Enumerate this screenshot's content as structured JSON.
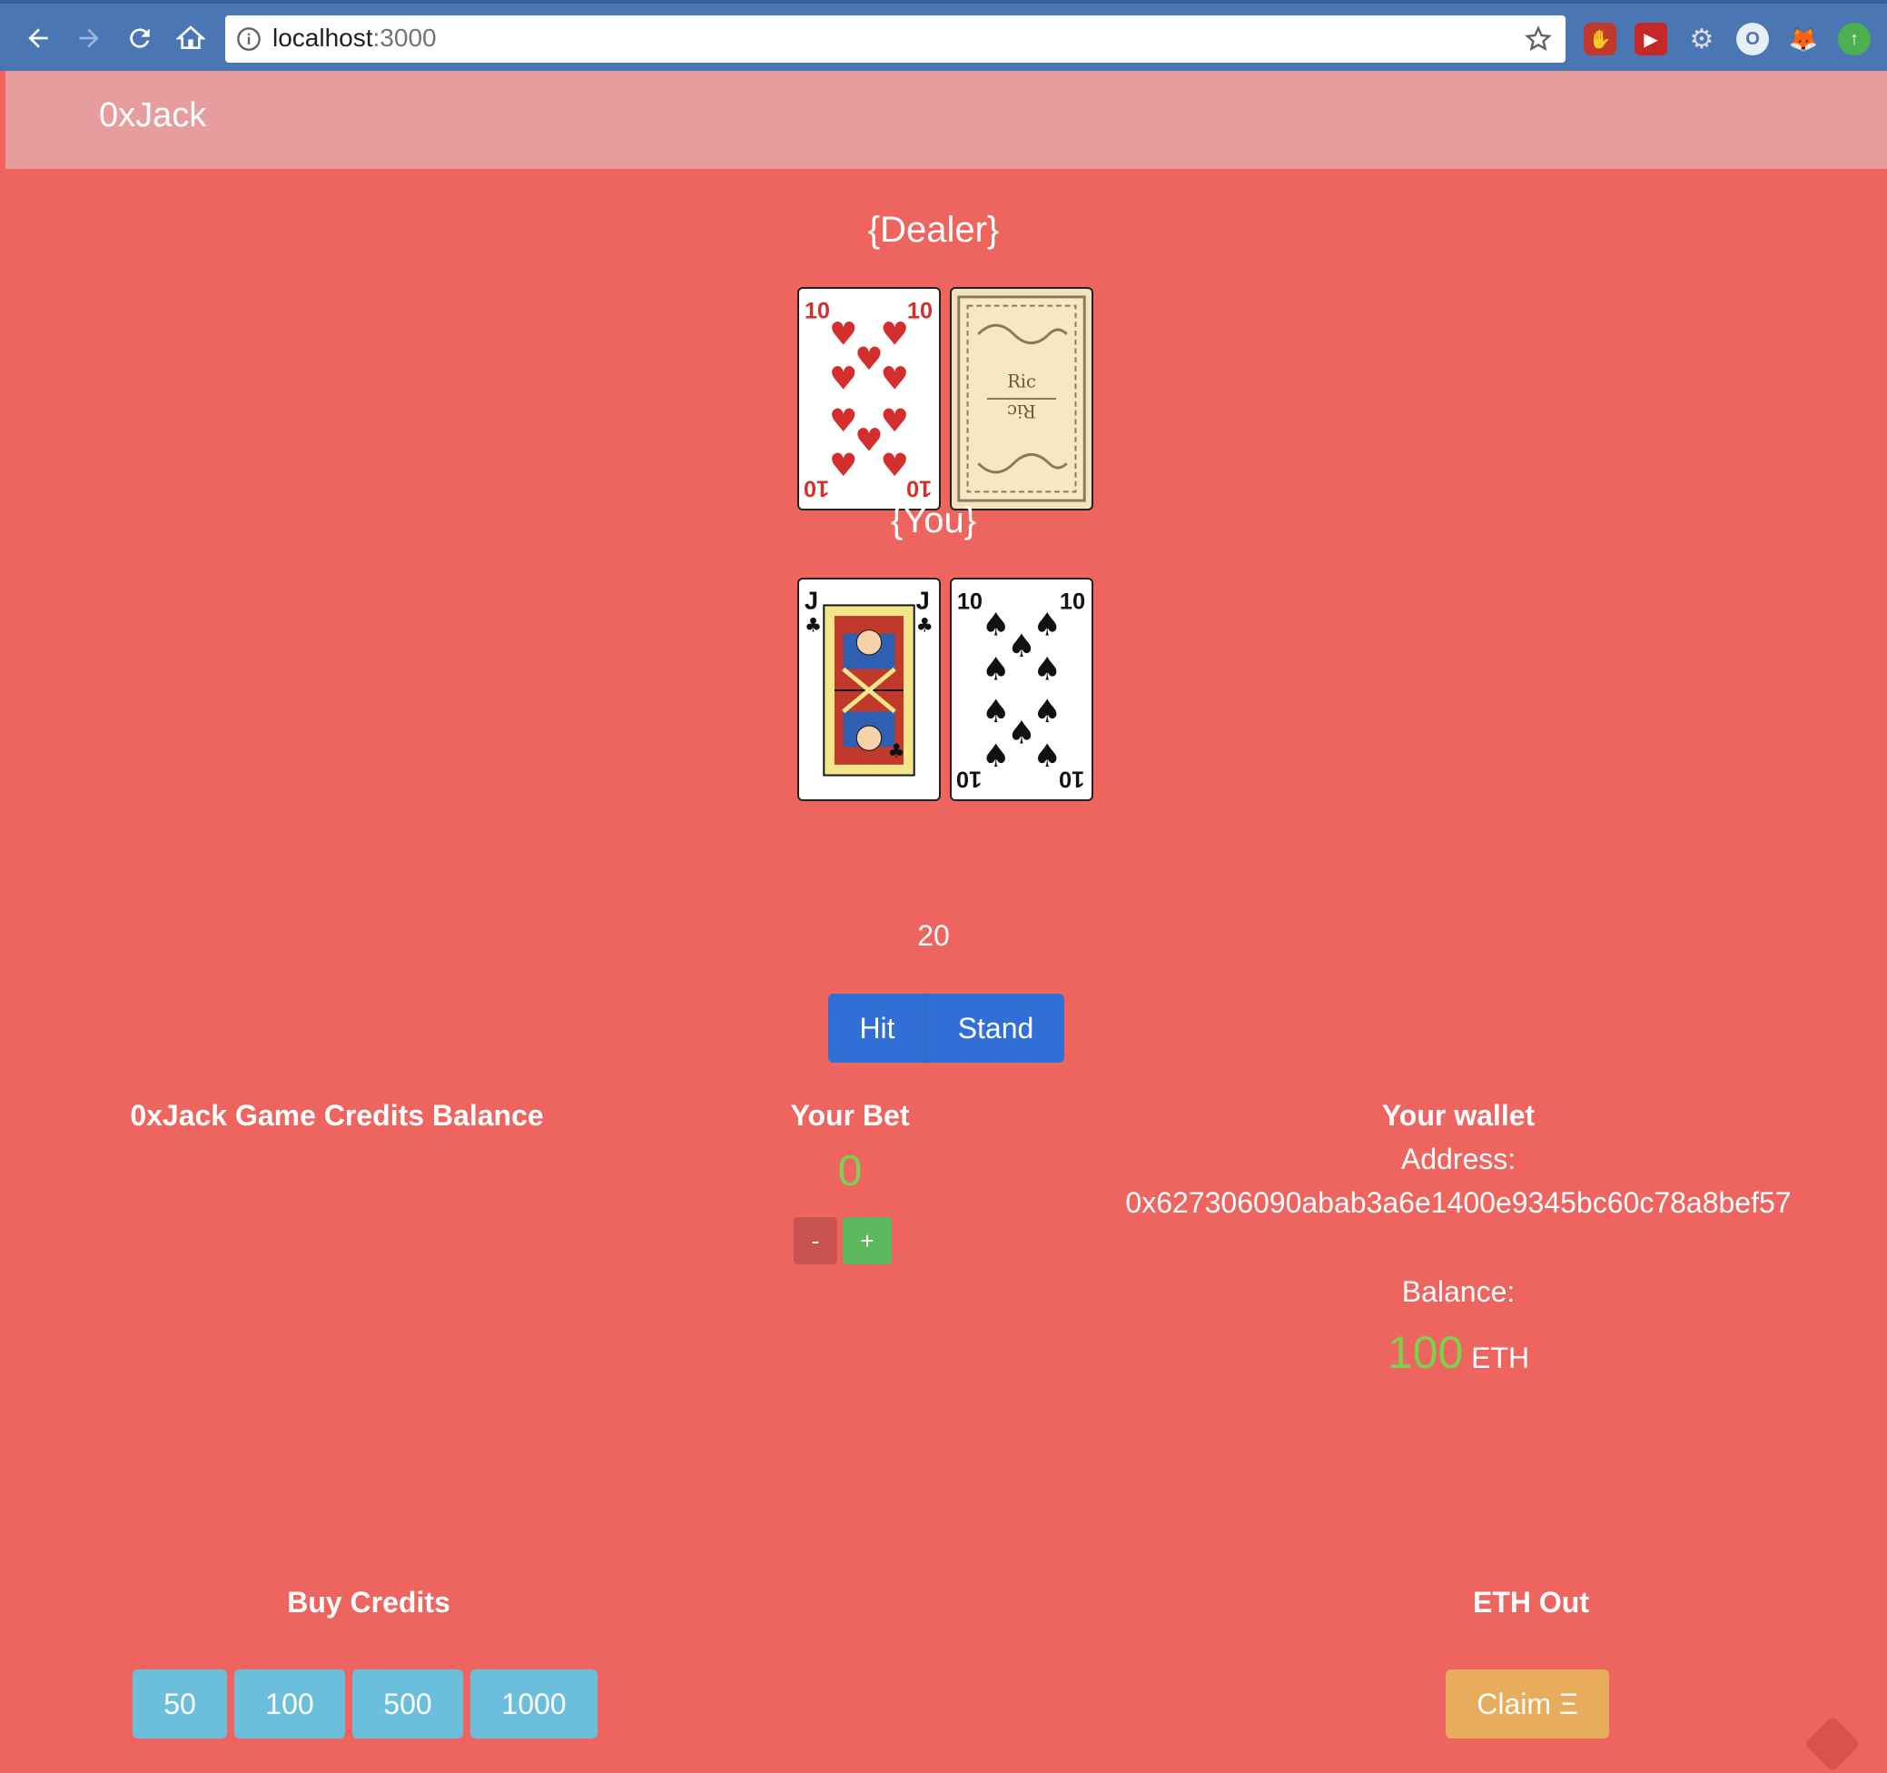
{
  "browser": {
    "url_host": "localhost",
    "url_port": ":3000",
    "extensions": [
      "ublock-icon",
      "video-speed-icon",
      "gear-icon",
      "opera-icon",
      "metamask-fox-icon",
      "update-arrow-icon"
    ]
  },
  "navbar": {
    "brand": "0xJack"
  },
  "dealer": {
    "title": "{Dealer}",
    "cards": [
      {
        "rank": "10",
        "suit": "hearts",
        "face_up": true
      },
      {
        "rank": "",
        "suit": "",
        "face_up": false,
        "back_text": "Ric"
      }
    ]
  },
  "player": {
    "title": "{You}",
    "cards": [
      {
        "rank": "J",
        "suit": "clubs",
        "face_up": true
      },
      {
        "rank": "10",
        "suit": "spades",
        "face_up": true
      }
    ],
    "score": "20"
  },
  "actions": {
    "hit": "Hit",
    "stand": "Stand"
  },
  "credits": {
    "title": "0xJack Game Credits Balance"
  },
  "bet": {
    "title": "Your Bet",
    "value": "0",
    "minus": "-",
    "plus": "+"
  },
  "wallet": {
    "title": "Your wallet",
    "address_label": "Address:",
    "address": "0x627306090abab3a6e1400e9345bc60c78a8bef57",
    "balance_label": "Balance:",
    "balance_value": "100",
    "balance_unit": "ETH"
  },
  "buy": {
    "title": "Buy Credits",
    "options": [
      "50",
      "100",
      "500",
      "1000"
    ]
  },
  "eth_out": {
    "title": "ETH Out",
    "claim": "Claim Ξ"
  },
  "colors": {
    "background": "#ee6560",
    "navbar": "#e79d9d",
    "primary": "#2f6fd6",
    "info": "#6cbfdc",
    "warning": "#e8ad5c",
    "success_text": "#7bd24f"
  }
}
